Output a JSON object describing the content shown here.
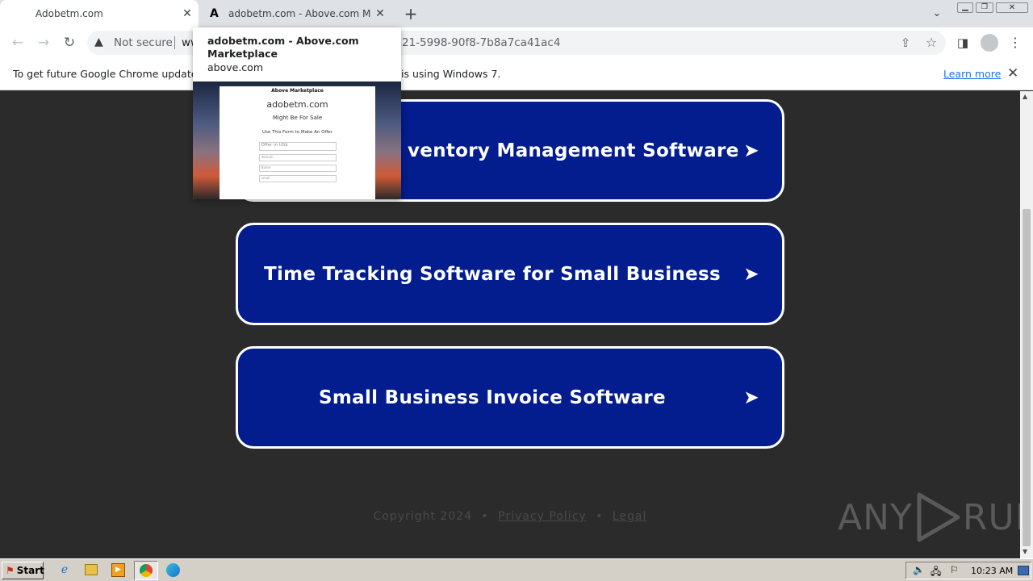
{
  "tabs": [
    {
      "title": "Adobetm.com",
      "active": true
    },
    {
      "title": "adobetm.com - Above.com Marketpl",
      "active": false
    }
  ],
  "toolbar": {
    "security_label": "Not secure",
    "url_visible_prefix": "ww",
    "url_visible_suffix": "21-5998-90f8-7b8a7ca41ac4"
  },
  "infobar": {
    "text_left": "To get future Google Chrome updates, y",
    "text_right": "is using Windows 7.",
    "learn_more": "Learn more"
  },
  "hovercard": {
    "title": "adobetm.com - Above.com Marketplace",
    "domain": "above.com",
    "preview": {
      "header_bold": "Above",
      "header_rest": "Marketplace",
      "site": "adobetm.com",
      "tagline": "Might Be For Sale",
      "instruction": "Use This Form to Make An Offer",
      "fields": [
        "Offer in US$",
        "domain",
        "Name",
        "email"
      ]
    }
  },
  "links": [
    {
      "label": "Inventory Management Software",
      "visible_label": "ventory Management Software",
      "arrow": "➤"
    },
    {
      "label": "Time Tracking Software for Small Business",
      "arrow": "➤"
    },
    {
      "label": "Small Business Invoice Software",
      "arrow": "➤"
    }
  ],
  "footer": {
    "copyright": "Copyright 2024",
    "separator": "•",
    "privacy": "Privacy Policy",
    "legal": "Legal"
  },
  "watermark": {
    "text_left": "ANY",
    "text_right": "RUN"
  },
  "taskbar": {
    "start_label": "Start",
    "clock": "10:23 AM",
    "icons": [
      "ie-icon",
      "folder-icon",
      "media-player-icon",
      "chrome-icon",
      "edge-icon"
    ]
  },
  "colors": {
    "button_bg": "#031c8e",
    "page_bg": "#2b2b2b",
    "button_border": "#ffffff"
  }
}
